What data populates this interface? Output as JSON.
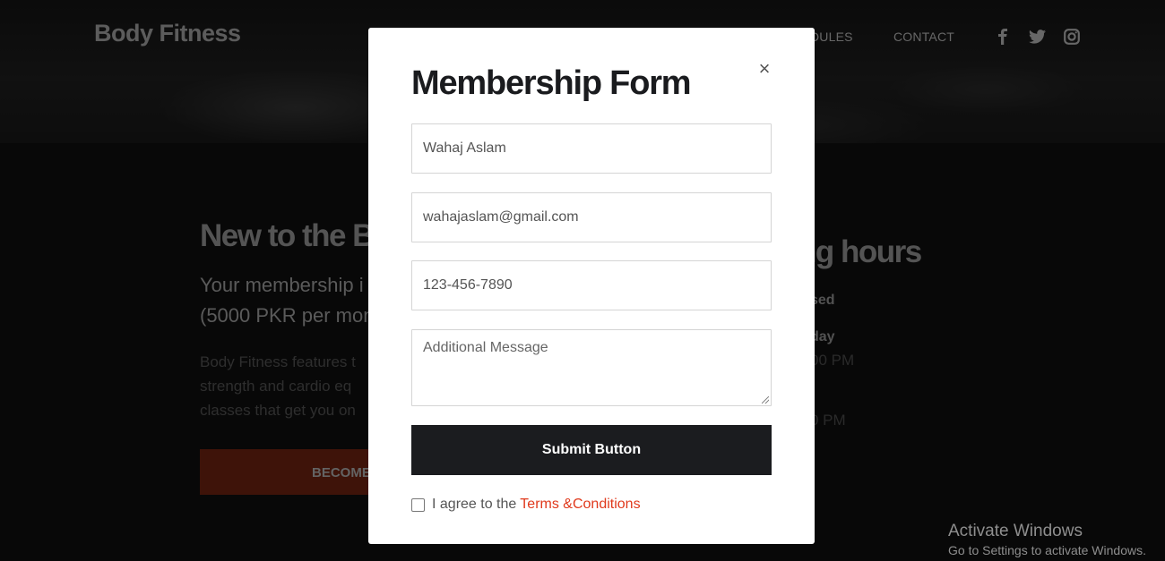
{
  "header": {
    "brand": "Body Fitness",
    "nav": [
      {
        "label": "DULES"
      },
      {
        "label": "CONTACT"
      }
    ],
    "social": [
      "facebook-icon",
      "twitter-icon",
      "instagram-icon"
    ]
  },
  "background": {
    "new_heading": "New to the B",
    "membership_lines": [
      "Your membership i",
      "(5000 PKR per mon"
    ],
    "description_lines": [
      "Body Fitness features t",
      "strength and cardio eq",
      "classes that get you on"
    ],
    "become_label": "BECOME",
    "hours_heading": "ng hours",
    "hours_bold": [
      "sed",
      "day"
    ],
    "hours_times": [
      "00 PM",
      "0 PM"
    ]
  },
  "modal": {
    "title": "Membership Form",
    "close_glyph": "×",
    "name_value": "Wahaj Aslam",
    "email_value": "wahajaslam@gmail.com",
    "phone_value": "123-456-7890",
    "message_placeholder": "Additional Message",
    "submit_label": "Submit Button",
    "agree_text": "I agree to the",
    "terms_label": "Terms &Conditions"
  },
  "windows_watermark": {
    "title": "Activate Windows",
    "subtitle": "Go to Settings to activate Windows."
  },
  "colors": {
    "accent": "#e0391c",
    "submit_bg": "#1b1c1f",
    "become_bg": "#7c2713"
  }
}
